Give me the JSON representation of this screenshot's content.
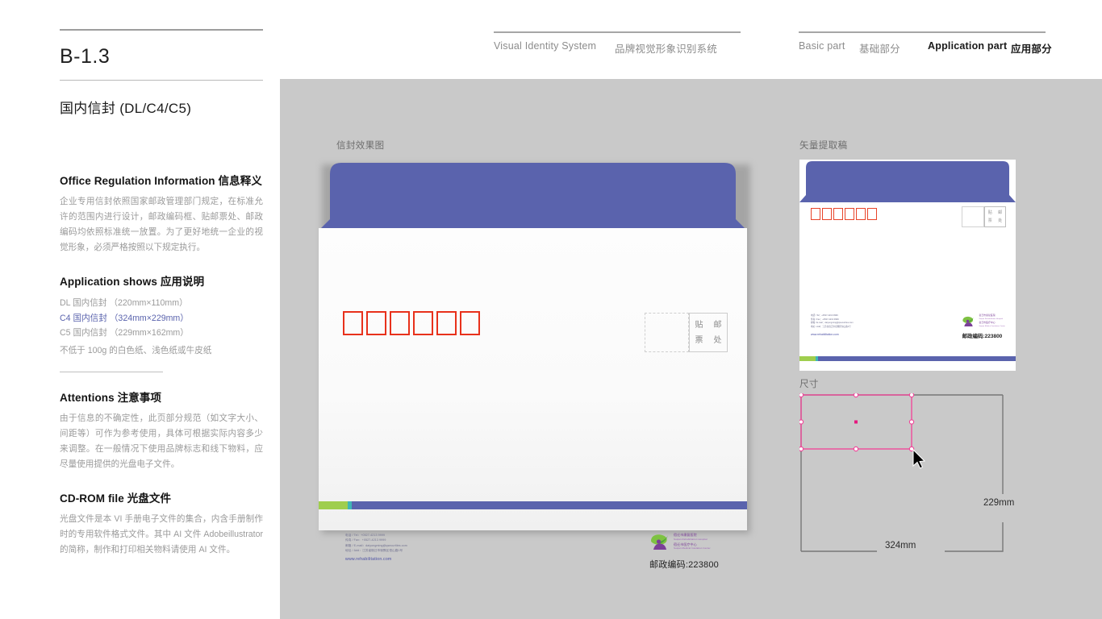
{
  "header": {
    "vis_en": "Visual Identity System",
    "vis_cn": "品牌视觉形象识别系统",
    "basic_en": "Basic part",
    "basic_cn": "基础部分",
    "app_en": "Application part",
    "app_cn": "应用部分"
  },
  "sidebar": {
    "code": "B-1.3",
    "doc_title": "国内信封 (DL/C4/C5)",
    "sections": [
      {
        "heading_en": "Office Regulation Information",
        "heading_cn": "信息释义",
        "body": "企业专用信封依照国家邮政管理部门规定，在标准允许的范围内进行设计，邮政编码框、贴邮票处、邮政编码均依照标准统一放置。为了更好地统一企业的视觉形象，必须严格按照以下规定执行。"
      },
      {
        "heading_en": "Application shows",
        "heading_cn": "应用说明",
        "specs": [
          {
            "label": "DL 国内信封",
            "size": "（220mm×110mm）",
            "highlight": false
          },
          {
            "label": "C4 国内信封",
            "size": "（324mm×229mm）",
            "highlight": true
          },
          {
            "label": "C5 国内信封",
            "size": "（229mm×162mm）",
            "highlight": false
          }
        ],
        "note": "不低于 100g 的白色纸、浅色纸或牛皮纸"
      },
      {
        "heading_en": "Attentions",
        "heading_cn": "注意事项",
        "body": "由于信息的不确定性，此页部分规范（如文字大小、间距等）可作为参考使用，具体可根据实际内容多少来调整。在一般情况下使用品牌标志和线下物料，应尽量使用提供的光盘电子文件。"
      },
      {
        "heading_en": "CD-ROM file",
        "heading_cn": "光盘文件",
        "body": "光盘文件是本 VI 手册电子文件的集合，内含手册制作时的专用软件格式文件。其中 AI 文件 Adobeillustrator 的简称，制作和打印相关物料请使用 AI 文件。"
      }
    ]
  },
  "canvas": {
    "mockup_label": "信封效果图",
    "vector_label": "矢量提取稿",
    "dims_label": "尺寸"
  },
  "envelope": {
    "stamp_chars": [
      "贴",
      "邮",
      "票",
      "处"
    ],
    "zip_box_count": 6,
    "contact": [
      "电话 / Tel：+0527-4213 9999",
      "传真 / Fax：+0527-4213 9999",
      "邮箱 / E-mail：daiyongming@qsecurities.com",
      "地址 / Add：江苏省宿迁市宿豫区恒山路1号"
    ],
    "website": "www.rehabilitation.com",
    "postcode_label": "邮政编码:",
    "postcode_value": "223800",
    "logo": {
      "cn_line1": "宿迁市康复医院",
      "en_line1": "Suqian Rehabilitation Hospital",
      "cn_line2": "宿迁市医疗中心",
      "en_line2": "Suqian Medical Insulation Center"
    }
  },
  "dimensions": {
    "width_label": "324mm",
    "height_label": "229mm"
  },
  "colors": {
    "brand_purple": "#5a63ad",
    "brand_green": "#9fce4e",
    "brand_teal": "#3fb6b6",
    "zip_red": "#e8311b",
    "selection_pink": "#ef4a9b",
    "canvas_gray": "#c9c9c9"
  }
}
